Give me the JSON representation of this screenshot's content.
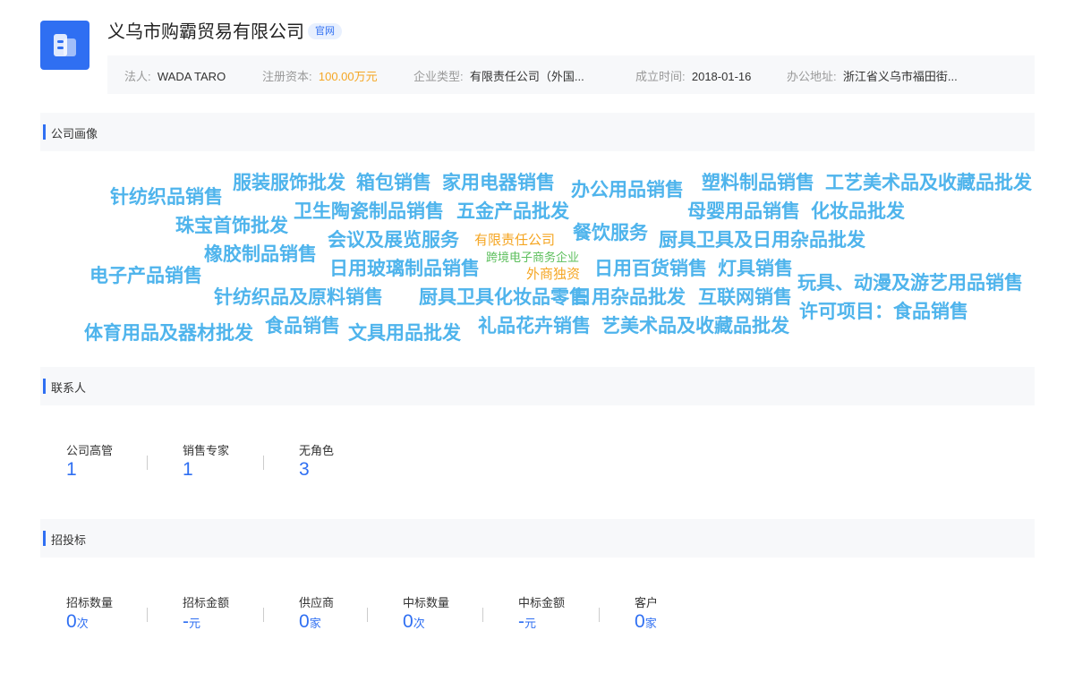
{
  "company": {
    "name": "义乌市购霸贸易有限公司",
    "badge": "官网",
    "info": [
      {
        "key": "法人:",
        "value": "WADA TARO"
      },
      {
        "key": "注册资本:",
        "value": "100.00万元"
      },
      {
        "key": "企业类型:",
        "value": "有限责任公司（外国..."
      },
      {
        "key": "成立时间:",
        "value": "2018-01-16"
      },
      {
        "key": "办公地址:",
        "value": "浙江省义乌市福田街..."
      }
    ]
  },
  "colors": {
    "accent": "#2f6ff2",
    "tag": "#4fb4ec",
    "orange": "#f5a623",
    "green": "#5cbf5c"
  },
  "portrait": {
    "title": "公司画像",
    "tags": [
      "针纺织品销售",
      "服装服饰批发",
      "箱包销售",
      "家用电器销售",
      "办公用品销售",
      "塑料制品销售",
      "工艺美术品及收藏品批发",
      "珠宝首饰批发",
      "卫生陶瓷制品销售",
      "五金产品批发",
      "母婴用品销售",
      "化妆品批发",
      "橡胶制品销售",
      "会议及展览服务",
      "有限责任公司",
      "餐饮服务",
      "厨具卫具及日用杂品批发",
      "电子产品销售",
      "日用玻璃制品销售",
      "跨境电子商务企业",
      "外商独资",
      "日用百货销售",
      "灯具销售",
      "针纺织品及原料销售",
      "厨具卫具化妆品零售",
      "日用杂品批发",
      "互联网销售",
      "玩具、动漫及游艺用品销售",
      "许可项目：食品销售",
      "体育用品及器材批发",
      "食品销售",
      "文具用品批发",
      "礼品花卉销售",
      "艺美术品及收藏品批发"
    ]
  },
  "contacts": {
    "title": "联系人",
    "stats": [
      {
        "label": "公司高管",
        "value": "1"
      },
      {
        "label": "销售专家",
        "value": "1"
      },
      {
        "label": "无角色",
        "value": "3"
      }
    ]
  },
  "bidding": {
    "title": "招投标",
    "stats": [
      {
        "label": "招标数量",
        "value": "0",
        "unit": "次"
      },
      {
        "label": "招标金额",
        "value": "-",
        "unit": "元"
      },
      {
        "label": "供应商",
        "value": "0",
        "unit": "家"
      },
      {
        "label": "中标数量",
        "value": "0",
        "unit": "次"
      },
      {
        "label": "中标金额",
        "value": "-",
        "unit": "元"
      },
      {
        "label": "客户",
        "value": "0",
        "unit": "家"
      }
    ]
  }
}
